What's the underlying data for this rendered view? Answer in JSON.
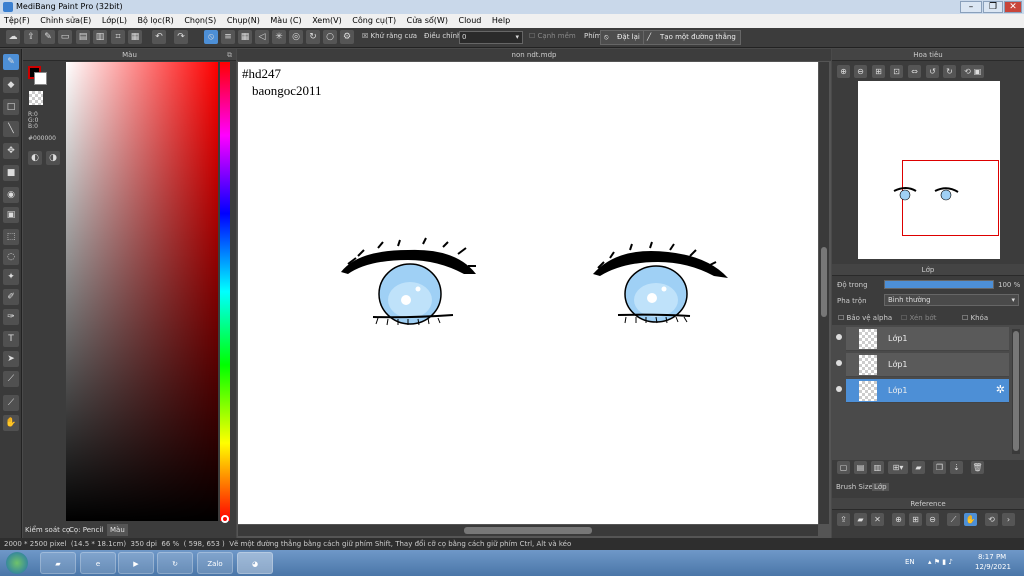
{
  "window": {
    "title": "MediBang Paint Pro (32bit)",
    "min": "–",
    "max": "❐",
    "close": "✕"
  },
  "menu": [
    "Tệp(F)",
    "Chỉnh sửa(E)",
    "Lớp(L)",
    "Bộ lọc(R)",
    "Chọn(S)",
    "Chụp(N)",
    "Màu (C)",
    "Xem(V)",
    "Công cụ(T)",
    "Cửa sổ(W)",
    "Cloud",
    "Help"
  ],
  "toolbar": {
    "antialias_label": "Khử răng cưa",
    "adjust_label": "Điều chỉnh",
    "adjust_value": "0",
    "smooth_label": "Cạnh mềm",
    "phim_label": "Phím",
    "reset_label": "Đặt lại",
    "straight_line_label": "Tạo một đường thẳng"
  },
  "color_panel": {
    "title": "Màu",
    "r": "R:0",
    "g": "G:0",
    "b": "B:0",
    "hex": "#000000",
    "tabs": [
      "Kiểm soát cọ",
      "Cọ: Pencil",
      "Màu"
    ]
  },
  "document": {
    "tab": "non ndt.mdp"
  },
  "canvas": {
    "tag": "#hd247",
    "author": "baongoc2011"
  },
  "navigator": {
    "title": "Hoa tiêu"
  },
  "layers_panel": {
    "title": "Lớp",
    "opacity_label": "Độ trong",
    "opacity_value": "100 %",
    "opacity_fraction": 1.0,
    "blend_label": "Pha trộn",
    "blend_value": "Bình thường",
    "protect_alpha": "Bảo vệ alpha",
    "clipping": "Xén bớt",
    "lock": "Khóa",
    "layers": [
      {
        "name": "Lớp1",
        "selected": false
      },
      {
        "name": "Lớp1",
        "selected": false
      },
      {
        "name": "Lớp1",
        "selected": true
      }
    ],
    "bottom_tabs": [
      "Brush Size",
      "Lớp"
    ]
  },
  "reference": {
    "title": "Reference"
  },
  "status": {
    "size": "2000 * 2500 pixel",
    "physical": "(14.5 * 18.1cm)",
    "dpi": "350 dpi",
    "zoom": "66 %",
    "coords": "( 598, 653 )",
    "hint": "Vẽ một đường thẳng bằng cách giữ phím Shift, Thay đổi cỡ cọ bằng cách giữ phím Ctrl, Alt và kéo"
  },
  "taskbar": {
    "lang": "EN",
    "time": "8:17 PM",
    "date": "12/9/2021",
    "apps": [
      "explorer",
      "ie",
      "media",
      "refresh",
      "Zalo",
      "chrome"
    ]
  },
  "colors": {
    "accent": "#4d8fd6",
    "iris": "#9fd0f5",
    "nav_frame": "#dd0000"
  }
}
